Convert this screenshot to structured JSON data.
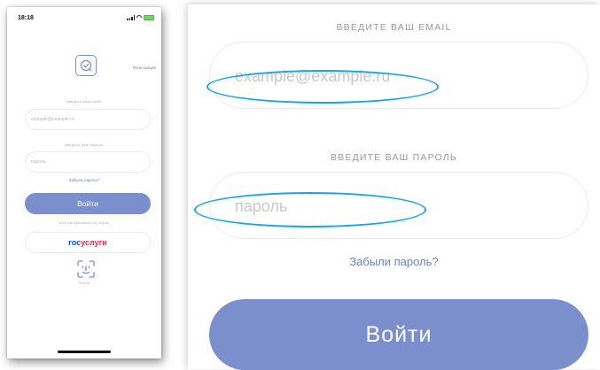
{
  "status_bar": {
    "time": "18:18"
  },
  "header": {
    "register_link": "Регистрация"
  },
  "email": {
    "label": "ВВЕДИТЕ ВАШ EMAIL",
    "small_label": "введите ваш email",
    "placeholder": "example@example.ru"
  },
  "password": {
    "label": "ВВЕДИТЕ ВАШ ПАРОЛЬ",
    "small_label": "введите ваш пароль",
    "placeholder": "пароль"
  },
  "forgot_link": "Забыли пароль?",
  "login_button": "Войти",
  "alt_login_text": "или авторизоваться через",
  "gosuslugi": {
    "part1": "гос",
    "part2": "услуги"
  },
  "face_id_label": "Face ID",
  "colors": {
    "accent": "#7b8fcc",
    "link": "#6a7fc1",
    "annotation": "#16a7e0",
    "gos_blue": "#0d4cd3",
    "gos_red": "#ee2f53"
  }
}
